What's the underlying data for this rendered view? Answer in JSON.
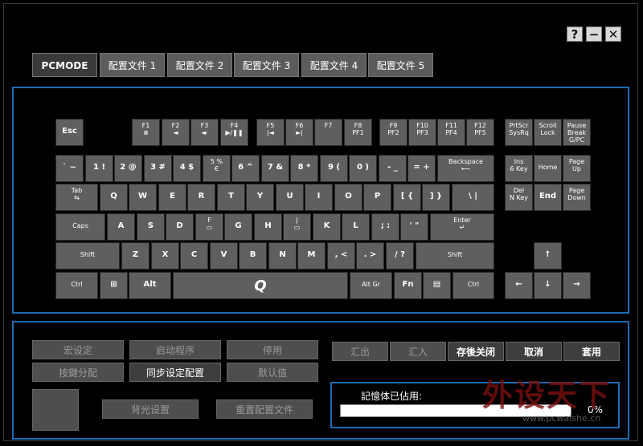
{
  "window": {
    "help": "?",
    "minimize": "−",
    "close": "✕"
  },
  "tabs": [
    "PCMODE",
    "配置文件 1",
    "配置文件 2",
    "配置文件 3",
    "配置文件 4",
    "配置文件 5"
  ],
  "keyboard": {
    "keys": [
      {
        "id": "esc",
        "l": [
          "Esc"
        ]
      },
      {
        "id": "f1",
        "l": [
          "F1",
          "⊗"
        ]
      },
      {
        "id": "f2",
        "l": [
          "F2",
          "◄"
        ]
      },
      {
        "id": "f3",
        "l": [
          "F3",
          "◄·"
        ]
      },
      {
        "id": "f4",
        "l": [
          "F4",
          "▶/❚❚"
        ]
      },
      {
        "id": "f5",
        "l": [
          "F5",
          "|◄"
        ]
      },
      {
        "id": "f6",
        "l": [
          "F6",
          "►|"
        ]
      },
      {
        "id": "f7",
        "l": [
          "F7",
          ""
        ]
      },
      {
        "id": "f8",
        "l": [
          "F8",
          "PF1"
        ]
      },
      {
        "id": "f9",
        "l": [
          "F9",
          "PF2"
        ]
      },
      {
        "id": "f10",
        "l": [
          "F10",
          "PF3"
        ]
      },
      {
        "id": "f11",
        "l": [
          "F11",
          "PF4"
        ]
      },
      {
        "id": "f12",
        "l": [
          "F12",
          "PF5"
        ]
      },
      {
        "id": "prtscr",
        "l": [
          "PrtScr",
          "SysRq"
        ]
      },
      {
        "id": "scrolllock",
        "l": [
          "Scroll",
          "Lock"
        ]
      },
      {
        "id": "pause",
        "l": [
          "Pause",
          "Break",
          "G/PC"
        ]
      },
      {
        "id": "grave",
        "l": [
          "` ~"
        ]
      },
      {
        "id": "k1",
        "l": [
          "1 !"
        ]
      },
      {
        "id": "k2",
        "l": [
          "2 @"
        ]
      },
      {
        "id": "k3",
        "l": [
          "3 #"
        ]
      },
      {
        "id": "k4",
        "l": [
          "4 $"
        ]
      },
      {
        "id": "k5",
        "l": [
          "5 %",
          "€"
        ]
      },
      {
        "id": "k6",
        "l": [
          "6 ^"
        ]
      },
      {
        "id": "k7",
        "l": [
          "7 &"
        ]
      },
      {
        "id": "k8",
        "l": [
          "8 *"
        ]
      },
      {
        "id": "k9",
        "l": [
          "9 ("
        ]
      },
      {
        "id": "k0",
        "l": [
          "0 )"
        ]
      },
      {
        "id": "minus",
        "l": [
          "- _"
        ]
      },
      {
        "id": "equal",
        "l": [
          "= +"
        ]
      },
      {
        "id": "backspace",
        "l": [
          "Backspace",
          "⟵"
        ]
      },
      {
        "id": "ins",
        "l": [
          "Ins",
          "",
          "6 Key"
        ]
      },
      {
        "id": "home",
        "l": [
          "Home"
        ]
      },
      {
        "id": "pgup",
        "l": [
          "Page",
          "Up"
        ]
      },
      {
        "id": "tab",
        "l": [
          "Tab",
          "⇆"
        ]
      },
      {
        "id": "q",
        "l": [
          "Q"
        ]
      },
      {
        "id": "w",
        "l": [
          "W"
        ]
      },
      {
        "id": "e",
        "l": [
          "E"
        ]
      },
      {
        "id": "r",
        "l": [
          "R"
        ]
      },
      {
        "id": "t",
        "l": [
          "T"
        ]
      },
      {
        "id": "y",
        "l": [
          "Y"
        ]
      },
      {
        "id": "u",
        "l": [
          "U"
        ]
      },
      {
        "id": "i",
        "l": [
          "I"
        ]
      },
      {
        "id": "o",
        "l": [
          "O"
        ]
      },
      {
        "id": "p",
        "l": [
          "P"
        ]
      },
      {
        "id": "lbr",
        "l": [
          "[ {"
        ]
      },
      {
        "id": "rbr",
        "l": [
          "] }"
        ]
      },
      {
        "id": "bslash",
        "l": [
          "\\ |"
        ]
      },
      {
        "id": "del",
        "l": [
          "Del",
          "",
          "N Key"
        ]
      },
      {
        "id": "end",
        "l": [
          "End"
        ]
      },
      {
        "id": "pgdn",
        "l": [
          "Page",
          "Down"
        ]
      },
      {
        "id": "caps",
        "l": [
          "Caps"
        ]
      },
      {
        "id": "a",
        "l": [
          "A"
        ]
      },
      {
        "id": "s",
        "l": [
          "S"
        ]
      },
      {
        "id": "d",
        "l": [
          "D"
        ]
      },
      {
        "id": "f",
        "l": [
          "F",
          "▭"
        ]
      },
      {
        "id": "g",
        "l": [
          "G"
        ]
      },
      {
        "id": "h",
        "l": [
          "H"
        ]
      },
      {
        "id": "j",
        "l": [
          "J",
          "▭"
        ]
      },
      {
        "id": "k",
        "l": [
          "K"
        ]
      },
      {
        "id": "l",
        "l": [
          "L"
        ]
      },
      {
        "id": "semi",
        "l": [
          "; :"
        ]
      },
      {
        "id": "quote",
        "l": [
          "' \""
        ]
      },
      {
        "id": "enter",
        "l": [
          "Enter",
          "↵"
        ]
      },
      {
        "id": "lshift",
        "l": [
          "Shift"
        ]
      },
      {
        "id": "z",
        "l": [
          "Z"
        ]
      },
      {
        "id": "x",
        "l": [
          "X"
        ]
      },
      {
        "id": "c",
        "l": [
          "C"
        ]
      },
      {
        "id": "v",
        "l": [
          "V"
        ]
      },
      {
        "id": "b",
        "l": [
          "B"
        ]
      },
      {
        "id": "n",
        "l": [
          "N"
        ]
      },
      {
        "id": "m",
        "l": [
          "M"
        ]
      },
      {
        "id": "comma",
        "l": [
          ", <"
        ]
      },
      {
        "id": "period",
        "l": [
          ". >"
        ]
      },
      {
        "id": "slash",
        "l": [
          "/ ?"
        ]
      },
      {
        "id": "rshift",
        "l": [
          "Shift"
        ]
      },
      {
        "id": "up",
        "l": [
          "↑"
        ]
      },
      {
        "id": "lctrl",
        "l": [
          "Ctrl"
        ]
      },
      {
        "id": "win",
        "l": [
          "⊞"
        ]
      },
      {
        "id": "alt",
        "l": [
          "Alt"
        ]
      },
      {
        "id": "space",
        "l": [
          "Q"
        ]
      },
      {
        "id": "altgr",
        "l": [
          "Alt Gr"
        ]
      },
      {
        "id": "fn",
        "l": [
          "Fn"
        ]
      },
      {
        "id": "menu",
        "l": [
          "▤"
        ]
      },
      {
        "id": "rctrl",
        "l": [
          "Ctrl"
        ]
      },
      {
        "id": "left",
        "l": [
          "←"
        ]
      },
      {
        "id": "down",
        "l": [
          "↓"
        ]
      },
      {
        "id": "right",
        "l": [
          "→"
        ]
      }
    ]
  },
  "controls": {
    "macro": "宏设定",
    "launch": "启动程序",
    "disable": "停用",
    "assign": "按鍵分配",
    "sync": "同步设定配置",
    "default": "默认值",
    "backlight": "背光设置",
    "reset": "重置配置文件",
    "export": "汇出",
    "import": "汇入",
    "save_close": "存後关闭",
    "cancel": "取消",
    "apply": "套用"
  },
  "memory": {
    "label": "記憶体已佔用:",
    "percent": "0%",
    "progress": 0
  },
  "watermark": {
    "text": "外设天下",
    "url": "www.pcwaishe.cn"
  }
}
